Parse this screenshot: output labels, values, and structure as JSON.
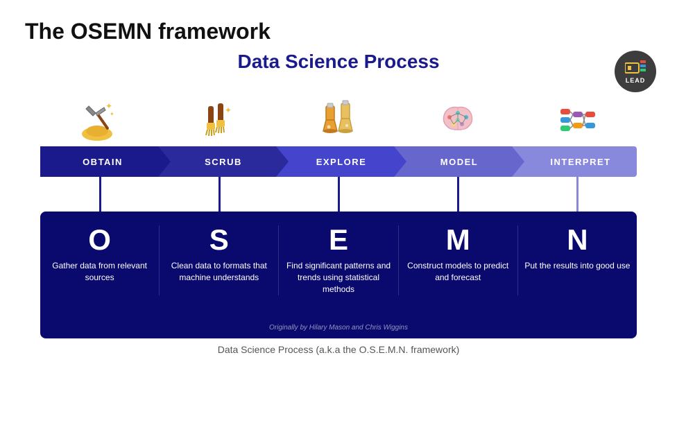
{
  "page": {
    "main_title": "The OSEMN framework",
    "diagram_title": "Data Science Process",
    "caption": "Data Science Process (a.k.a the O.S.E.M.N. framework)",
    "attribution": "Originally by Hilary Mason and Chris Wiggins",
    "lead_label": "LEAD",
    "arrows": [
      {
        "id": "obtain",
        "label": "OBTAIN",
        "color": "#1a1a8c"
      },
      {
        "id": "scrub",
        "label": "SCRUB",
        "color": "#2a2a9c"
      },
      {
        "id": "explore",
        "label": "EXPLORE",
        "color": "#4444cc"
      },
      {
        "id": "model",
        "label": "MODEL",
        "color": "#6666cc"
      },
      {
        "id": "interpret",
        "label": "INTERPRET",
        "color": "#8888dd"
      }
    ],
    "steps": [
      {
        "letter": "O",
        "description": "Gather data from relevant sources"
      },
      {
        "letter": "S",
        "description": "Clean data to formats that machine understands"
      },
      {
        "letter": "E",
        "description": "Find significant patterns and trends using statistical methods"
      },
      {
        "letter": "M",
        "description": "Construct models to predict and forecast"
      },
      {
        "letter": "N",
        "description": "Put the results into good use"
      }
    ]
  }
}
